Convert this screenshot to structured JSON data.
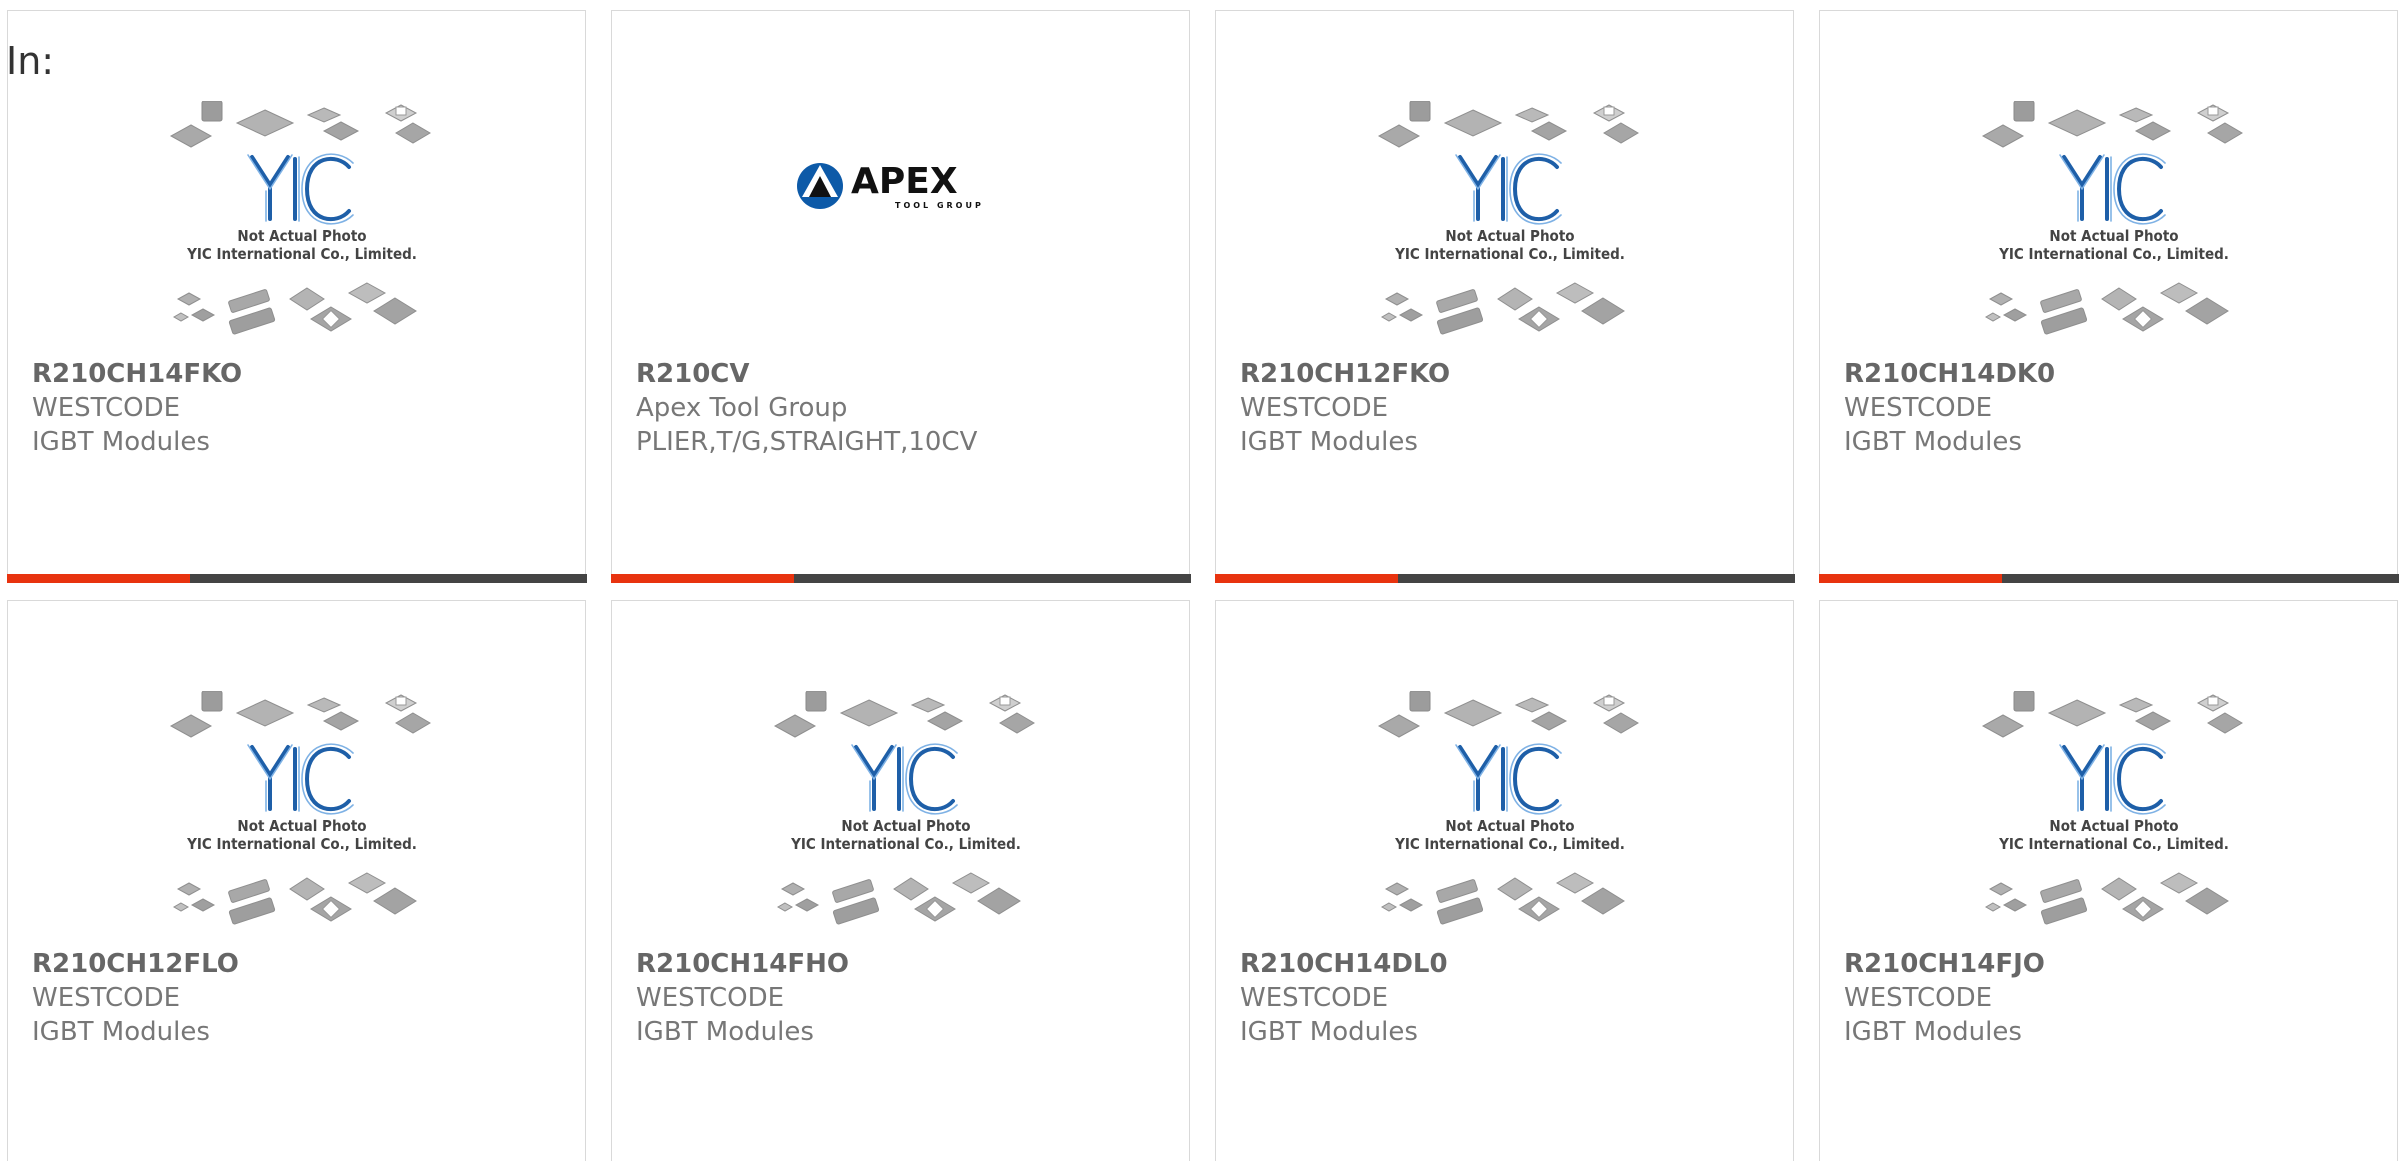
{
  "label_in": "In:",
  "colors": {
    "accent_bar": "#e8330f",
    "dark_bar": "#444444",
    "card_border": "#d9d9d9",
    "yic_blue": "#1e5fa8"
  },
  "placeholder_image": {
    "line1": "Not Actual Photo",
    "line2": "YIC International Co., Limited.",
    "logo_text": "YIC"
  },
  "apex_logo": {
    "name": "APEX",
    "tagline": "TOOL GROUP"
  },
  "products": [
    {
      "part_number": "R210CH14FKO",
      "manufacturer": "WESTCODE",
      "description": "IGBT Modules",
      "image": "yic-placeholder"
    },
    {
      "part_number": "R210CV",
      "manufacturer": "Apex Tool Group",
      "description": "PLIER,T/G,STRAIGHT,10CV",
      "image": "apex-logo"
    },
    {
      "part_number": "R210CH12FKO",
      "manufacturer": "WESTCODE",
      "description": "IGBT Modules",
      "image": "yic-placeholder"
    },
    {
      "part_number": "R210CH14DK0",
      "manufacturer": "WESTCODE",
      "description": "IGBT Modules",
      "image": "yic-placeholder"
    },
    {
      "part_number": "R210CH12FLO",
      "manufacturer": "WESTCODE",
      "description": "IGBT Modules",
      "image": "yic-placeholder"
    },
    {
      "part_number": "R210CH14FHO",
      "manufacturer": "WESTCODE",
      "description": "IGBT Modules",
      "image": "yic-placeholder"
    },
    {
      "part_number": "R210CH14DL0",
      "manufacturer": "WESTCODE",
      "description": "IGBT Modules",
      "image": "yic-placeholder"
    },
    {
      "part_number": "R210CH14FJO",
      "manufacturer": "WESTCODE",
      "description": "IGBT Modules",
      "image": "yic-placeholder"
    }
  ]
}
